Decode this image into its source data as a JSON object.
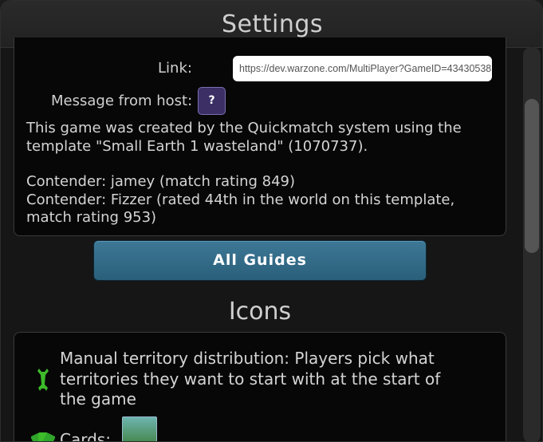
{
  "title": "Settings",
  "link": {
    "label": "Link:",
    "value": "https://dev.warzone.com/MultiPlayer?GameID=43430538"
  },
  "host_message": {
    "label": "Message from host:",
    "button": "?"
  },
  "description": {
    "line1": "This game was created by the Quickmatch system using the",
    "line2": "template \"Small Earth 1 wasteland\" (1070737).",
    "contender1": "Contender: jamey (match rating 849)",
    "contender2a": "Contender: Fizzer (rated 44th in the world on this template,",
    "contender2b": "match rating 953)"
  },
  "guides_button": "All Guides",
  "icons_section": {
    "title": "Icons",
    "items": [
      {
        "icon": "wrench-icon",
        "line1": "Manual territory distribution: Players pick what",
        "line2": "territories they want to start with at the start of",
        "line3": "the game"
      },
      {
        "icon": "cards-icon",
        "label": "Cards:"
      }
    ]
  },
  "colors": {
    "accent_button": "#2f6a86",
    "help_button": "#3b2f66",
    "wrench": "#3dbb2a"
  }
}
